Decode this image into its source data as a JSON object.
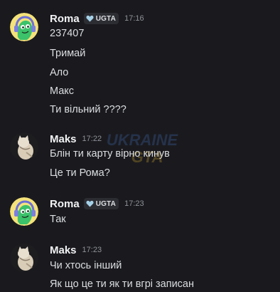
{
  "messages": [
    {
      "author": "Roma",
      "badge": "UGTA",
      "time": "17:16",
      "lines": [
        "237407",
        "Тримай",
        "Ало",
        "Макс",
        "Ти вільний ????"
      ]
    },
    {
      "author": "Maks",
      "time": "17:22",
      "lines": [
        "Блін ти карту вірно кинув",
        "Це ти Рома?"
      ]
    },
    {
      "author": "Roma",
      "badge": "UGTA",
      "time": "17:23",
      "lines": [
        "Так"
      ]
    },
    {
      "author": "Maks",
      "time": "17:23",
      "lines": [
        "Чи хтось інший",
        "Як що це ти як ти вгрі записан"
      ]
    }
  ],
  "watermark": {
    "line1": "UKRAINE",
    "line2": "GTA"
  },
  "colors": {
    "background": "#1a1a1e",
    "username": "#f2f3f5",
    "message_text": "#dbdee1",
    "timestamp": "#8e9199",
    "badge_bg": "#2c2d33",
    "heart_badge": "#a6d2e8",
    "roma_avatar_bg": "#f4e27a",
    "roma_avatar_char": "#3bc26a"
  },
  "icons": {
    "roma_avatar": "green-creature-headphones-avatar",
    "maks_avatar": "white-cat-avatar",
    "badge_icon": "heart-icon"
  }
}
